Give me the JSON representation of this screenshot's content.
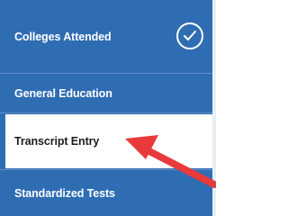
{
  "nav": {
    "items": [
      {
        "label": "Colleges Attended",
        "completed": true
      },
      {
        "label": "General Education"
      },
      {
        "label": "Transcript Entry",
        "active": true
      },
      {
        "label": "Standardized Tests"
      }
    ]
  },
  "colors": {
    "nav_bg": "#2f6db3",
    "active_bg": "#ffffff",
    "annotation_arrow": "#e8393b"
  },
  "icons": {
    "completed": "check-circle-icon",
    "annotation": "red-arrow-icon"
  }
}
